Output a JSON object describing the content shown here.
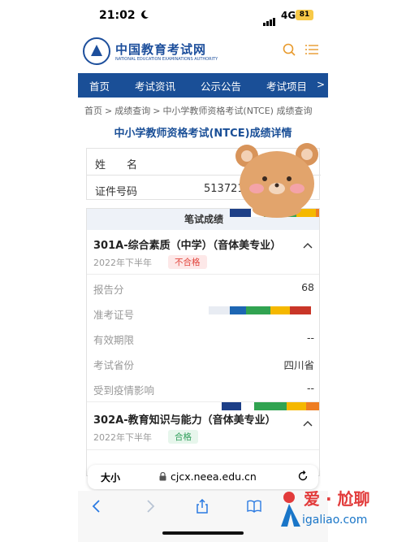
{
  "status_bar": {
    "time": "21:02",
    "network": "4G",
    "battery": "81"
  },
  "site": {
    "name": "中国教育考试网",
    "subtitle": "NATIONAL EDUCATION EXAMINATIONS AUTHORITY"
  },
  "nav": {
    "items": [
      "首页",
      "考试资讯",
      "公示公告",
      "考试项目"
    ],
    "more": ">"
  },
  "breadcrumb": [
    "首页",
    "成绩查询",
    "中小学教师资格考试(NTCE) 成绩查询"
  ],
  "page_title": "中小学教师资格考试(NTCE)成绩详情",
  "personal": {
    "name_label": "姓　　名",
    "id_label": "证件号码",
    "id_value": "5137211"
  },
  "exam": {
    "header": "笔试成绩",
    "subjects": [
      {
        "title": "301A-综合素质（中学）（音体美专业）",
        "term": "2022年下半年",
        "status": "不合格",
        "fields": [
          {
            "label": "报告分",
            "value": "68"
          },
          {
            "label": "准考证号",
            "value": ""
          },
          {
            "label": "有效期限",
            "value": "--"
          },
          {
            "label": "考试省份",
            "value": "四川省"
          },
          {
            "label": "受到疫情影响",
            "value": "--"
          }
        ]
      },
      {
        "title": "302A-教育知识与能力（音体美专业）",
        "term": "2022年下半年",
        "status": "合格"
      }
    ]
  },
  "browser": {
    "text_size_label": "大小",
    "url": "cjcx.neea.edu.cn"
  },
  "watermark": {
    "line1": "爱 · 尬聊",
    "line2": "igaliao.com"
  },
  "colors": {
    "brand_blue": "#1a4f97",
    "fail_red": "#e2453c",
    "pass_green": "#2f9e5a"
  }
}
